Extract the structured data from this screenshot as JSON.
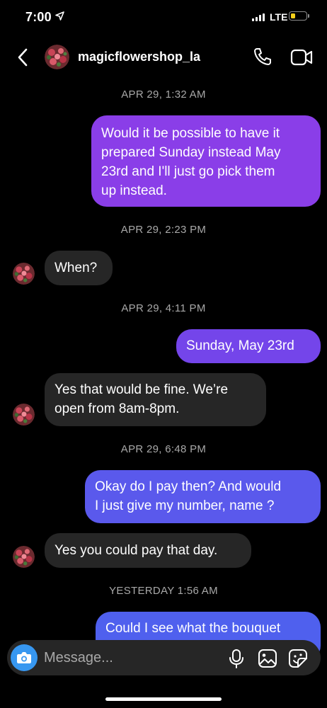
{
  "status_bar": {
    "time": "7:00",
    "network": "LTE",
    "battery_level": 0.25
  },
  "header": {
    "username": "magicflowershop_la"
  },
  "thread": {
    "timestamps": [
      "APR 29, 1:32 AM",
      "APR 29, 2:23 PM",
      "APR 29, 4:11 PM",
      "APR 29, 6:48 PM",
      "YESTERDAY 1:56 AM"
    ],
    "messages": [
      {
        "from": "me",
        "lines": [
          "Would it be possible to have it",
          "prepared Sunday instead May",
          "23rd and I'll just go pick them",
          "up instead."
        ]
      },
      {
        "from": "them",
        "lines": [
          "When?"
        ]
      },
      {
        "from": "me",
        "lines": [
          "Sunday, May 23rd"
        ]
      },
      {
        "from": "them",
        "lines": [
          "Yes that would be fine. We’re",
          "open from 8am-8pm."
        ]
      },
      {
        "from": "me",
        "lines": [
          "Okay do I pay then? And would",
          "I just give my number,  name ?"
        ]
      },
      {
        "from": "them",
        "lines": [
          "Yes you could pay that day."
        ]
      },
      {
        "from": "me",
        "lines": [
          "Could I see what the bouquet"
        ]
      }
    ]
  },
  "composer": {
    "placeholder": "Message..."
  },
  "colors": {
    "sent_purple": "#8a3ee8",
    "sent_violet": "#7445ea",
    "sent_blue": "#5a59ec",
    "received": "#262626",
    "camera_blue": "#3797f0"
  }
}
